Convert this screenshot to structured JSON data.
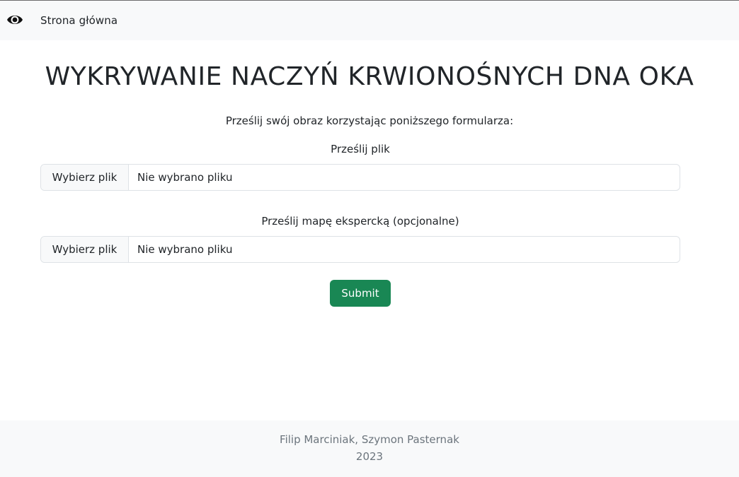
{
  "navbar": {
    "brand_icon": "eye-icon",
    "home_link": "Strona główna"
  },
  "main": {
    "title": "WYKRYWANIE NACZYŃ KRWIONOŚNYCH DNA OKA",
    "lead": "Prześlij swój obraz korzystając poniższego formularza:",
    "upload_file": {
      "label": "Prześlij plik",
      "button": "Wybierz plik",
      "status": "Nie wybrano pliku"
    },
    "upload_expert_map": {
      "label": "Prześlij mapę ekspercką (opcjonalne)",
      "button": "Wybierz plik",
      "status": "Nie wybrano pliku"
    },
    "submit_label": "Submit"
  },
  "footer": {
    "authors": "Filip Marciniak, Szymon Pasternak",
    "year": "2023"
  },
  "colors": {
    "navbar_bg": "#f8f9fa",
    "submit_bg": "#198754",
    "footer_text": "#6c757d"
  }
}
